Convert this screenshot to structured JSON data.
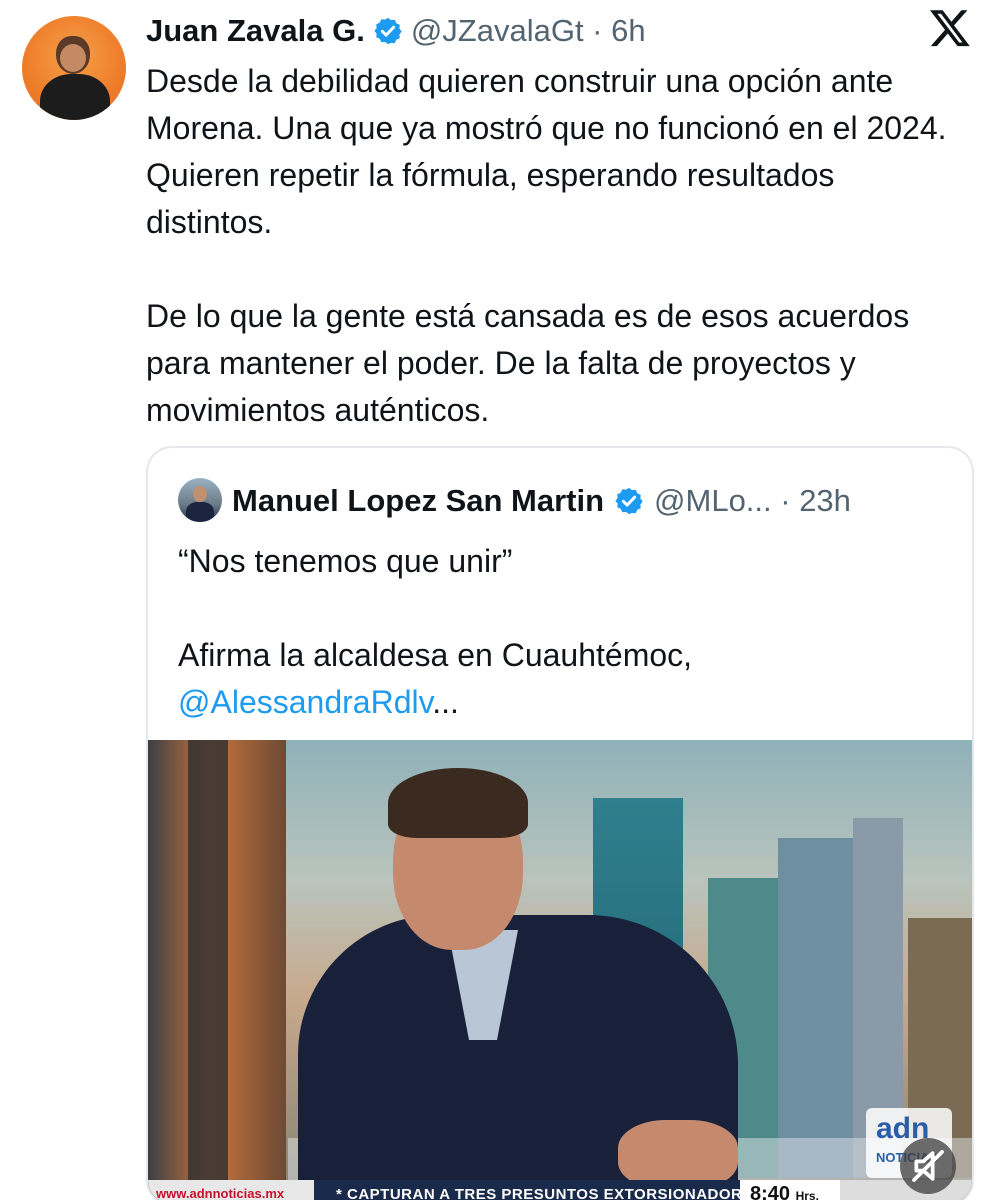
{
  "tweet": {
    "author_name": "Juan Zavala G.",
    "handle_time": "@JZavalaGt · 6h",
    "text": "Desde la debilidad quieren construir una opción ante Morena. Una que ya mostró que no funcionó en el 2024. Quieren repetir la fórmula, esperando resultados distintos.\n\nDe lo que la gente está cansada es de esos acuerdos para mantener el poder. De la falta de proyectos y movimientos auténticos."
  },
  "quote": {
    "author_name": "Manuel Lopez San Martin",
    "handle_time": "@MLo... · 23h",
    "line1": "“Nos tenemos que unir”",
    "line2": "Afirma la alcaldesa en Cuauhtémoc,",
    "mention": "@AlessandraRdlv",
    "ellipsis": "..."
  },
  "video": {
    "ticker_url": "www.adnnoticias.mx",
    "ticker_text": "* CAPTURAN A TRES PRESUNTOS EXTORSIONADORES",
    "ticker_time": "8:40",
    "ticker_time_unit": "Hrs.",
    "logo_text": "adn",
    "logo_sub": "NOTICIAS"
  },
  "icons": {
    "verified": "verified-badge-icon",
    "x_logo": "x-logo-icon",
    "mute": "muted-speaker-icon"
  },
  "colors": {
    "verified": "#1d9bf0",
    "mention": "#1d9bf0",
    "secondary_text": "#536471"
  }
}
